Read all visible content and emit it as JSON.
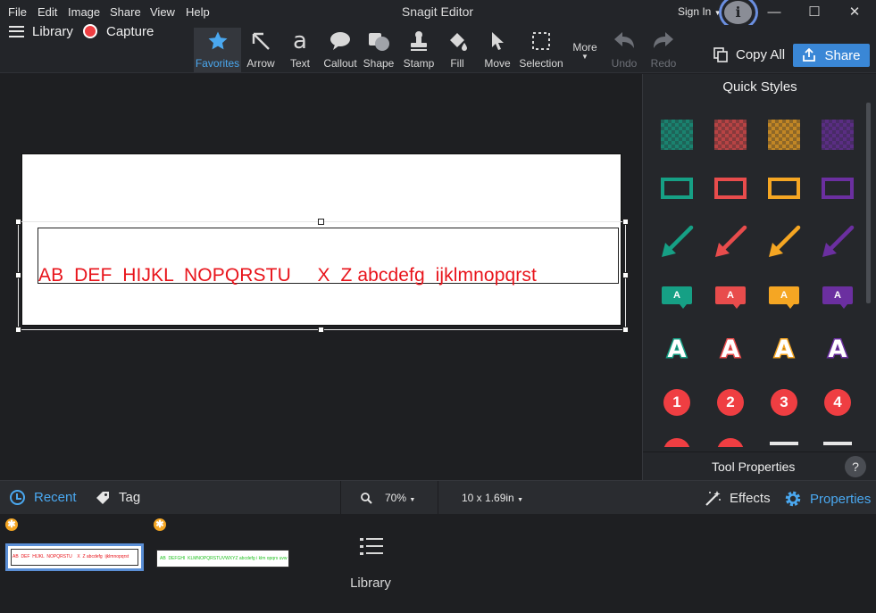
{
  "menu": {
    "items": [
      "File",
      "Edit",
      "Image",
      "Share",
      "View",
      "Help"
    ],
    "app_title": "Snagit Editor",
    "sign_in": "Sign In",
    "info_icon": "i"
  },
  "window_controls": {
    "minimize": "—",
    "maximize": "☐",
    "close": "✕"
  },
  "toolbar": {
    "library_label": "Library",
    "capture_label": "Capture",
    "tools": [
      {
        "label": "Favorites",
        "icon": "star-icon",
        "active": true
      },
      {
        "label": "Arrow",
        "icon": "arrow-icon"
      },
      {
        "label": "Text",
        "icon": "text-icon"
      },
      {
        "label": "Callout",
        "icon": "callout-icon"
      },
      {
        "label": "Shape",
        "icon": "shape-icon"
      },
      {
        "label": "Stamp",
        "icon": "stamp-icon"
      },
      {
        "label": "Fill",
        "icon": "fill-icon"
      },
      {
        "label": "Move",
        "icon": "move-icon"
      },
      {
        "label": "Selection",
        "icon": "selection-icon"
      },
      {
        "label": "More",
        "icon": "chevron-down-icon"
      },
      {
        "label": "Undo",
        "icon": "undo-icon",
        "disabled": true
      },
      {
        "label": "Redo",
        "icon": "redo-icon",
        "disabled": true
      }
    ],
    "copy_all_label": "Copy All",
    "share_label": "Share"
  },
  "canvas": {
    "capture_text": "AB  DEF  HIJKL  NOPQRSTU     X  Z abcdefg  ijklmnopqrst",
    "text_color": "#e8141b"
  },
  "quick_styles": {
    "title": "Quick Styles",
    "colors": [
      "#16a085",
      "#e84c4c",
      "#f5a623",
      "#6b2fa0"
    ],
    "callout_letter": "A",
    "outline_letter": "A",
    "numbers": [
      "1",
      "2",
      "3",
      "4"
    ],
    "tool_properties_label": "Tool Properties",
    "help_label": "?"
  },
  "bottombar": {
    "recent_label": "Recent",
    "tag_label": "Tag",
    "zoom_value": "70%",
    "size_value": "10 x 1.69in",
    "effects_label": "Effects",
    "properties_label": "Properties"
  },
  "tray": {
    "thumb1_text": "AB  DEF  HIJKL  NOPQRSTU    X  Z abcdefg  ijklmnopqrst",
    "thumb2_text": "AB  DEFGHI  KLMNOPQRSTUVWXYZ abcdefg i klm opqrs uvw",
    "library_label": "Library"
  }
}
